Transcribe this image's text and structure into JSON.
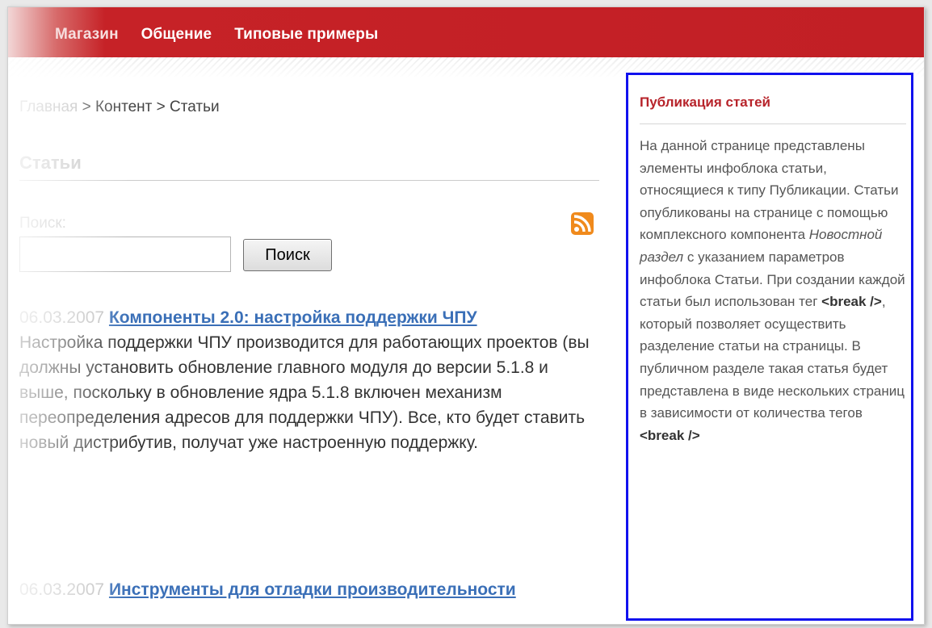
{
  "nav": {
    "items": [
      "Магазин",
      "Общение",
      "Типовые примеры"
    ]
  },
  "breadcrumb": {
    "home": "Главная",
    "sep1": " > ",
    "content": "Контент",
    "sep2": " > ",
    "current": "Статьи"
  },
  "page": {
    "title": "Статьи"
  },
  "search": {
    "label": "Поиск:",
    "value": "",
    "button_label": "Поиск"
  },
  "articles": [
    {
      "date": "06.03.2007",
      "title": "Компоненты 2.0: настройка поддержки ЧПУ",
      "preview": "Настройка поддержки ЧПУ производится для работающих проектов (вы должны установить обновление главного модуля до версии 5.1.8 и выше, поскольку в обновление ядра 5.1.8 включен механизм переопределения адресов для поддержки ЧПУ). Все, кто будет ставить новый дистрибутив, получат уже настроенную поддержку."
    },
    {
      "date": "06.03.2007",
      "title": "Инструменты для отладки производительности"
    }
  ],
  "sidebar": {
    "title": "Публикация статей",
    "text_1": "На данной странице представлены элементы инфоблока статьи, относящиеся к типу Публикации. Статьи опубликованы на странице с помощью комплексного компонента ",
    "text_em": "Новостной раздел",
    "text_2": " с указанием параметров инфоблока Статьи. При создании каждой статьи был использован тег ",
    "tag_1": "<break />",
    "text_3": ", который позволяет осуществить разделение статьи на страницы. В публичном разделе такая статья будет представлена в виде нескольких страниц в зависимости от количества тегов ",
    "tag_2": "<break />"
  },
  "colors": {
    "topbar": "#c21f25",
    "link": "#3a6fb7",
    "sidebar_border": "#1111ee",
    "sidebar_title": "#b7232a",
    "rss": "#f08a1c"
  },
  "icons": {
    "rss": "rss-feed-icon"
  }
}
